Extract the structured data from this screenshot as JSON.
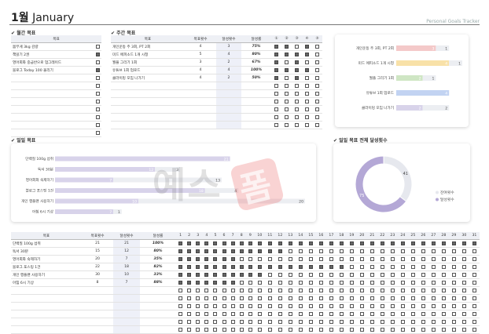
{
  "header": {
    "month_num": "1월",
    "month_name": "January",
    "brand": "Personal Goals Tracker"
  },
  "monthly": {
    "section_title": "✔ 월간 목표",
    "col_goal": "목표",
    "rows": [
      {
        "goal": "몸무게 3kg 감량",
        "done": false
      },
      {
        "goal": "책읽기 2권",
        "done": true
      },
      {
        "goal": "영어회화 중급반으로 업그레이드",
        "done": false
      },
      {
        "goal": "블로그 Today 100 올리기",
        "done": true
      }
    ],
    "empty_rows": 8
  },
  "weekly": {
    "section_title": "✔ 주간 목표",
    "col_goal": "목표",
    "col_target": "목표횟수",
    "col_achieved": "달성횟수",
    "col_rate": "달성률",
    "days": [
      "1",
      "2",
      "3",
      "4",
      "5"
    ],
    "day_marks": [
      "①",
      "②",
      "③",
      "④",
      "⑤"
    ],
    "rows": [
      {
        "goal": "개인운동 주 3회, PT 2회",
        "target": "4",
        "achieved": "3",
        "rate": "75%",
        "checks": [
          true,
          true,
          false,
          true,
          false
        ]
      },
      {
        "goal": "미드 에피소드 1개 시청",
        "target": "5",
        "achieved": "4",
        "rate": "80%",
        "checks": [
          true,
          true,
          true,
          true,
          false
        ]
      },
      {
        "goal": "월플 그리기 1회",
        "target": "3",
        "achieved": "2",
        "rate": "67%",
        "checks": [
          true,
          false,
          true,
          false,
          false
        ]
      },
      {
        "goal": "유튜브 1회 업로드",
        "target": "4",
        "achieved": "4",
        "rate": "100%",
        "checks": [
          true,
          true,
          true,
          true,
          false
        ]
      },
      {
        "goal": "클라이밍 모임 나가기",
        "target": "4",
        "achieved": "2",
        "rate": "50%",
        "checks": [
          true,
          false,
          true,
          false,
          false
        ]
      }
    ],
    "empty_rows": 6
  },
  "weekly_chart": {
    "type": "bar",
    "categories": [
      "개인운동 주 3회, PT 2회",
      "미드 에피소드 1개 시청",
      "월플 그리기 1회",
      "유튜브 1회 업로드",
      "클라이밍 모임 나가기"
    ],
    "achieved": [
      3,
      4,
      2,
      4,
      2
    ],
    "remaining": [
      1,
      1,
      1,
      0,
      2
    ],
    "colors": [
      "#f4c9c9",
      "#f8e1a8",
      "#cfe6c4",
      "#c2d3f2",
      "#d8d3ea"
    ]
  },
  "daily": {
    "section_title": "✔ 일일 목표",
    "chart_section_title": "✔ 일일 목표 전체 달성횟수",
    "col_goal": "목표",
    "col_target": "목표횟수",
    "col_achieved": "달성횟수",
    "col_rate": "달성률",
    "days": [
      "1",
      "2",
      "3",
      "4",
      "5",
      "6",
      "7",
      "8",
      "9",
      "10",
      "11",
      "12",
      "13",
      "14",
      "15",
      "16",
      "17",
      "18",
      "19",
      "20",
      "21",
      "22",
      "23",
      "24",
      "25",
      "26",
      "27",
      "28",
      "29",
      "30",
      "31"
    ],
    "rows": [
      {
        "goal": "단백질 100g 섭취",
        "target": "21",
        "achieved": "21",
        "rate": "100%",
        "checks": "1111111111111111111111111111111"
      },
      {
        "goal": "독서 30분",
        "target": "15",
        "achieved": "12",
        "rate": "80%",
        "checks": "1111111111110000000000000000000"
      },
      {
        "goal": "영어회화 숙제하기",
        "target": "20",
        "achieved": "7",
        "rate": "35%",
        "checks": "1111111000000000000000000000000"
      },
      {
        "goal": "블로그 포스팅 1건",
        "target": "22",
        "achieved": "18",
        "rate": "82%",
        "checks": "1111111111111111110000000000000"
      },
      {
        "goal": "개인 행플랜 사용하기",
        "target": "30",
        "achieved": "10",
        "rate": "33%",
        "checks": "1111111111000000000000000000000"
      },
      {
        "goal": "아침 6시 기상",
        "target": "8",
        "achieved": "7",
        "rate": "88%",
        "checks": "1111111000000000000000000000000"
      }
    ],
    "empty_rows": 6
  },
  "daily_chart": {
    "type": "bar",
    "categories": [
      "단백질 100g 섭취",
      "독서 30분",
      "영어회화 숙제하기",
      "블로그 포스팅 1건",
      "개인 행플랜 사용하기",
      "아침 6시 기상"
    ],
    "achieved": [
      21,
      12,
      7,
      18,
      10,
      7
    ],
    "remaining": [
      0,
      3,
      13,
      4,
      20,
      1
    ],
    "achieved_color": "#d8d3ea",
    "remaining_color": "#eceef2"
  },
  "donut": {
    "type": "pie",
    "labels": [
      "잔여횟수",
      "달성횟수"
    ],
    "values": [
      41,
      75
    ],
    "colors": [
      "#e6e8ee",
      "#b4a8d6"
    ]
  },
  "watermark": "예스폼"
}
